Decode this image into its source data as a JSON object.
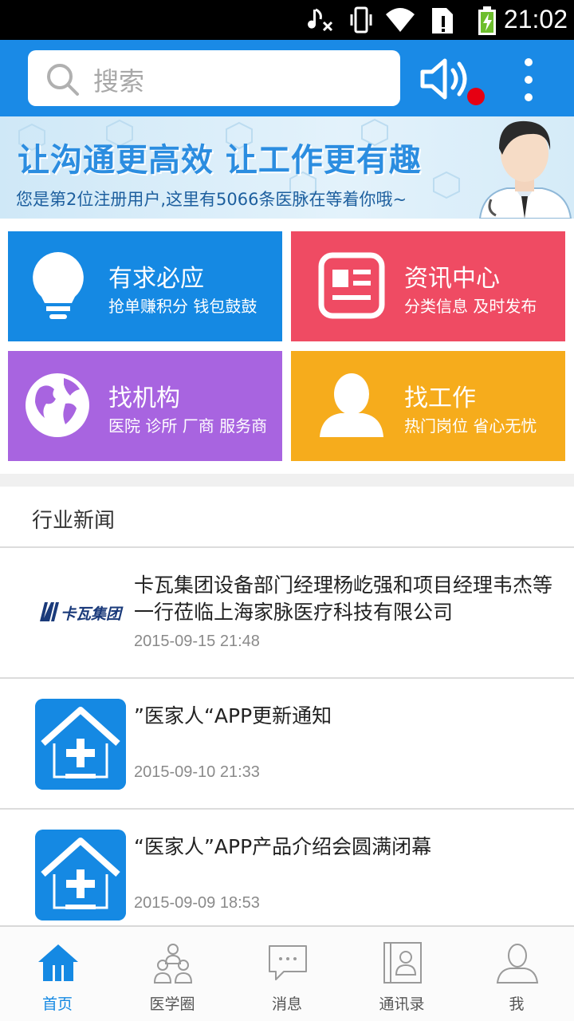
{
  "status_bar": {
    "time": "21:02",
    "icons": [
      "music-muted-icon",
      "vibrate-icon",
      "wifi-icon",
      "sim-alert-icon",
      "battery-charging-icon"
    ]
  },
  "header": {
    "search_placeholder": "搜索",
    "icons": [
      "search-icon",
      "speaker-icon",
      "more-icon"
    ],
    "accent_color": "#1a8ae6"
  },
  "banner": {
    "slogan": "让沟通更高效  让工作更有趣",
    "subtitle": "您是第2位注册用户,这里有5066条医脉在等着你哦~"
  },
  "tiles": [
    {
      "title": "有求必应",
      "subtitle": "抢单赚积分 钱包鼓鼓",
      "icon": "lightbulb-icon",
      "color": "#1589e3"
    },
    {
      "title": "资讯中心",
      "subtitle": "分类信息 及时发布",
      "icon": "news-icon",
      "color": "#ef4b63"
    },
    {
      "title": "找机构",
      "subtitle": "医院 诊所 厂商 服务商",
      "icon": "globe-icon",
      "color": "#a864e0"
    },
    {
      "title": "找工作",
      "subtitle": "热门岗位 省心无忧",
      "icon": "person-icon",
      "color": "#f6ac1c"
    }
  ],
  "news_section": {
    "title": "行业新闻",
    "items": [
      {
        "title": "卡瓦集团设备部门经理杨屹强和项目经理韦杰等一行莅临上海家脉医疗科技有限公司",
        "date": "2015-09-15 21:48",
        "logo_text": "卡瓦集团"
      },
      {
        "title": "”医家人“APP更新通知",
        "date": "2015-09-10 21:33"
      },
      {
        "title": "“医家人”APP产品介绍会圆满闭幕",
        "date": "2015-09-09 18:53"
      }
    ]
  },
  "tabbar": {
    "items": [
      {
        "label": "首页",
        "icon": "home-icon",
        "active": true
      },
      {
        "label": "医学圈",
        "icon": "group-icon",
        "active": false
      },
      {
        "label": "消息",
        "icon": "chat-icon",
        "active": false
      },
      {
        "label": "通讯录",
        "icon": "contacts-icon",
        "active": false
      },
      {
        "label": "我",
        "icon": "profile-icon",
        "active": false
      }
    ]
  }
}
